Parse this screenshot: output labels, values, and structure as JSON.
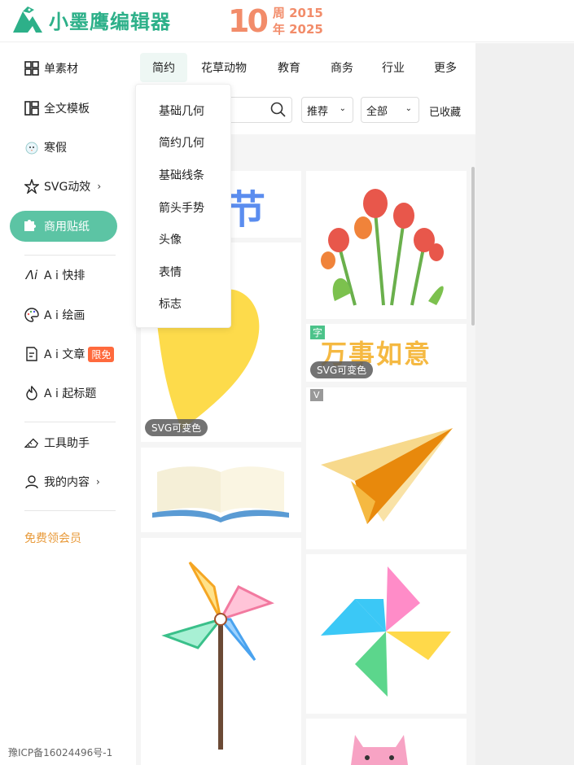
{
  "header": {
    "logo_text": "小墨鹰编辑器",
    "anniv_number": "10",
    "anniv_line1": "周 2015",
    "anniv_line2": "年 2025"
  },
  "sidebar": {
    "items": [
      {
        "label": "单素材",
        "icon": "grid-icon"
      },
      {
        "label": "全文模板",
        "icon": "template-icon"
      },
      {
        "label": "寒假",
        "icon": "snowman-icon"
      },
      {
        "label": "SVG动效",
        "icon": "star-icon"
      },
      {
        "label": "商用贴纸",
        "icon": "puzzle-icon"
      },
      {
        "label": "A i 快排",
        "icon": "ai-icon"
      },
      {
        "label": "A i 绘画",
        "icon": "palette-icon"
      },
      {
        "label": "A i 文章",
        "icon": "document-icon",
        "badge": "限免"
      },
      {
        "label": "A i 起标题",
        "icon": "flame-icon"
      },
      {
        "label": "工具助手",
        "icon": "tools-icon"
      },
      {
        "label": "我的内容",
        "icon": "user-icon"
      }
    ],
    "free_member": "免费领会员",
    "icp": "豫ICP备16024496号-1"
  },
  "tabs": [
    "简约",
    "花草动物",
    "教育",
    "商务",
    "行业",
    "更多"
  ],
  "filters": {
    "sort": "推荐",
    "scope": "全部",
    "favorites": "已收藏"
  },
  "dropdown": [
    "基础几何",
    "简约几何",
    "基础线条",
    "箭头手势",
    "头像",
    "表情",
    "标志"
  ],
  "cards": {
    "partial_title": "节",
    "wanshi": "万事如意",
    "svg_tag": "SVG可变色",
    "char_tag": "字",
    "v_tag": "V"
  },
  "colors": {
    "brand": "#2db089",
    "active_bg": "#5cc4a4",
    "accent_orange": "#f28c6a",
    "badge": "#ff6a3d"
  }
}
